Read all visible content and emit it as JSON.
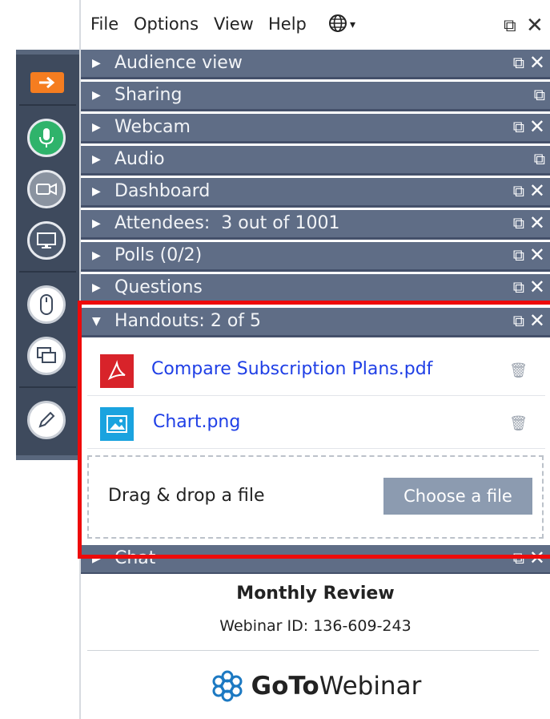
{
  "menubar": {
    "items": [
      "File",
      "Options",
      "View",
      "Help"
    ],
    "language_icon": "globe-icon",
    "language_caret": "▾"
  },
  "panes": [
    {
      "label": "Audience view",
      "expanded": false,
      "closable": true
    },
    {
      "label": "Sharing",
      "expanded": false,
      "closable": false
    },
    {
      "label": "Webcam",
      "expanded": false,
      "closable": true
    },
    {
      "label": "Audio",
      "expanded": false,
      "closable": false
    },
    {
      "label": "Dashboard",
      "expanded": false,
      "closable": true
    },
    {
      "label": "Attendees:  3 out of 1001",
      "expanded": false,
      "closable": true
    },
    {
      "label": "Polls (0/2)",
      "expanded": false,
      "closable": true
    },
    {
      "label": "Questions",
      "expanded": false,
      "closable": true
    },
    {
      "label": "Handouts: 2 of 5",
      "expanded": true,
      "closable": true
    },
    {
      "label": "Chat",
      "expanded": false,
      "closable": true
    }
  ],
  "handouts": {
    "files": [
      {
        "name": "Compare Subscription Plans.pdf",
        "type": "pdf"
      },
      {
        "name": "Chart.png",
        "type": "image"
      }
    ],
    "drop_text": "Drag & drop a file",
    "choose_label": "Choose a file"
  },
  "footer": {
    "title": "Monthly Review",
    "webinar_id": "Webinar ID: 136-609-243",
    "brand_go": "GoTo",
    "brand_rest": "Webinar"
  },
  "toolbar": {
    "icons": [
      "arrow-right-icon",
      "microphone-icon",
      "webcam-icon",
      "screen-icon",
      "mouse-icon",
      "screens-icon",
      "pen-icon"
    ]
  },
  "colors": {
    "pane_header": "#5f6d86",
    "toolbar": "#3e4a5d",
    "accent_orange": "#f57d20",
    "mic_green": "#2fb36b",
    "link_blue": "#1f3fe6",
    "highlight_red": "#ee0a0a"
  }
}
